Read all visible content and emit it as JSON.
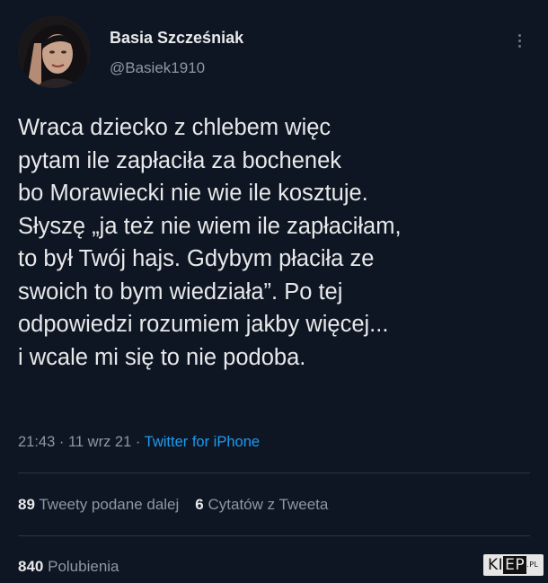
{
  "author": {
    "name": "Basia Szcześniak",
    "handle": "@Basiek1910"
  },
  "tweet": {
    "lines": [
      "Wraca dziecko z chlebem więc",
      "pytam ile zapłaciła za bochenek",
      "bo Morawiecki nie wie ile kosztuje.",
      "Słyszę „ja też nie wiem ile zapłaciłam,",
      "to był Twój hajs. Gdybym płaciła ze",
      "swoich to bym wiedziała”. Po tej",
      "odpowiedzi rozumiem jakby więcej...",
      "i wcale mi się to nie podoba."
    ],
    "time": "21:43",
    "separator": " · ",
    "date": "11 wrz 21",
    "source": "Twitter for iPhone"
  },
  "stats": {
    "retweets_count": "89",
    "retweets_label": "Tweety podane dalej",
    "quotes_count": "6",
    "quotes_label": "Cytatów z Tweeta",
    "likes_count": "840",
    "likes_label": "Polubienia"
  },
  "watermark": {
    "k": "K",
    "i": "I",
    "ep": "EP",
    "pl": ".PL"
  },
  "icons": {
    "more": "more-vertical-icon"
  },
  "colors": {
    "background": "#0f1623",
    "text": "#e7e9ea",
    "secondary": "#8b98a5",
    "link": "#1d9bf0"
  }
}
